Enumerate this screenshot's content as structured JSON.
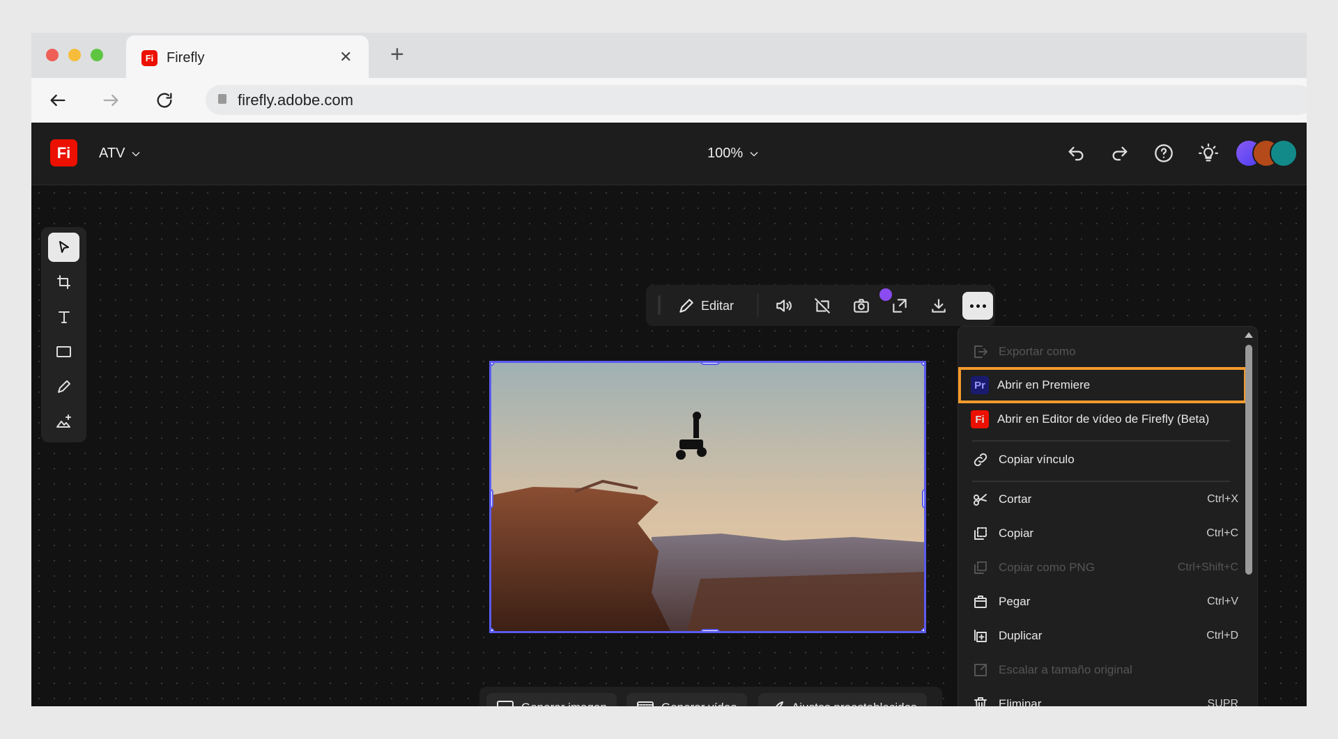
{
  "browser": {
    "tab_title": "Firefly",
    "url": "firefly.adobe.com",
    "new_tab": "+",
    "close": "✕"
  },
  "app": {
    "logo": "Fi",
    "project": "ATV",
    "zoom": "100%"
  },
  "toolbar": {
    "edit_label": "Editar"
  },
  "menu": {
    "items": [
      {
        "label": "Exportar como",
        "shortcut": "",
        "disabled": true,
        "icon": "export-icon"
      },
      {
        "label": "Abrir en Premiere",
        "shortcut": "",
        "badge": "Pr",
        "highlighted": true
      },
      {
        "label": "Abrir en Editor de vídeo de Firefly (Beta)",
        "shortcut": "",
        "badge": "Fi"
      },
      {
        "label": "Copiar vínculo",
        "shortcut": "",
        "icon": "link-icon"
      },
      {
        "label": "Cortar",
        "shortcut": "Ctrl+X",
        "icon": "scissors-icon"
      },
      {
        "label": "Copiar",
        "shortcut": "Ctrl+C",
        "icon": "copy-icon"
      },
      {
        "label": "Copiar como PNG",
        "shortcut": "Ctrl+Shift+C",
        "disabled": true,
        "icon": "copy-png-icon"
      },
      {
        "label": "Pegar",
        "shortcut": "Ctrl+V",
        "icon": "paste-icon"
      },
      {
        "label": "Duplicar",
        "shortcut": "Ctrl+D",
        "icon": "duplicate-icon"
      },
      {
        "label": "Escalar a tamaño original",
        "shortcut": "",
        "disabled": true,
        "icon": "scale-icon"
      },
      {
        "label": "Eliminar",
        "shortcut": "SUPR",
        "icon": "trash-icon"
      }
    ]
  },
  "bottom": {
    "gen_image": "Generar imagen",
    "gen_video": "Generar vídeo",
    "presets": "Ajustes preestablecidos"
  },
  "colors": {
    "accent": "#5b5bf0",
    "highlight": "#f39a2c",
    "brand": "#eb1000",
    "premiere": "#1a1a6e"
  }
}
